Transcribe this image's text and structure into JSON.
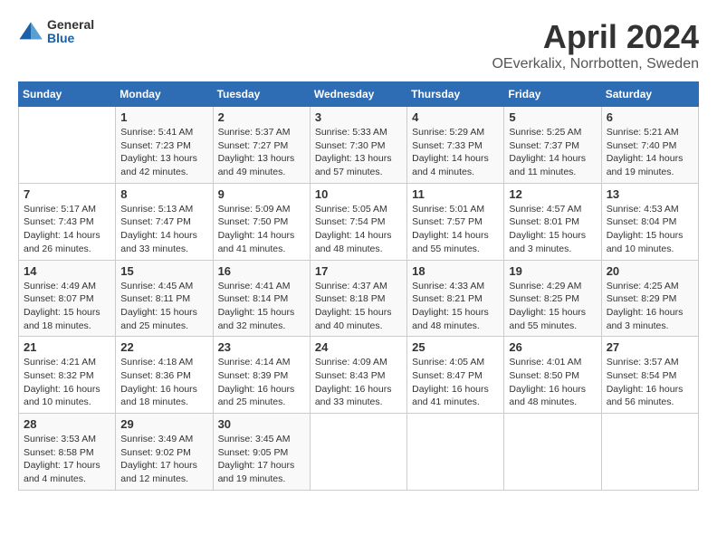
{
  "header": {
    "logo": {
      "general": "General",
      "blue": "Blue"
    },
    "title": "April 2024",
    "subtitle": "OEverkalix, Norrbotten, Sweden"
  },
  "columns": [
    "Sunday",
    "Monday",
    "Tuesday",
    "Wednesday",
    "Thursday",
    "Friday",
    "Saturday"
  ],
  "weeks": [
    [
      {
        "day": "",
        "sunrise": "",
        "sunset": "",
        "daylight": ""
      },
      {
        "day": "1",
        "sunrise": "5:41 AM",
        "sunset": "7:23 PM",
        "hours": "13 hours",
        "minutes": "and 42 minutes."
      },
      {
        "day": "2",
        "sunrise": "5:37 AM",
        "sunset": "7:27 PM",
        "hours": "13 hours",
        "minutes": "and 49 minutes."
      },
      {
        "day": "3",
        "sunrise": "5:33 AM",
        "sunset": "7:30 PM",
        "hours": "13 hours",
        "minutes": "and 57 minutes."
      },
      {
        "day": "4",
        "sunrise": "5:29 AM",
        "sunset": "7:33 PM",
        "hours": "14 hours",
        "minutes": "and 4 minutes."
      },
      {
        "day": "5",
        "sunrise": "5:25 AM",
        "sunset": "7:37 PM",
        "hours": "14 hours",
        "minutes": "and 11 minutes."
      },
      {
        "day": "6",
        "sunrise": "5:21 AM",
        "sunset": "7:40 PM",
        "hours": "14 hours",
        "minutes": "and 19 minutes."
      }
    ],
    [
      {
        "day": "7",
        "sunrise": "5:17 AM",
        "sunset": "7:43 PM",
        "hours": "14 hours",
        "minutes": "and 26 minutes."
      },
      {
        "day": "8",
        "sunrise": "5:13 AM",
        "sunset": "7:47 PM",
        "hours": "14 hours",
        "minutes": "and 33 minutes."
      },
      {
        "day": "9",
        "sunrise": "5:09 AM",
        "sunset": "7:50 PM",
        "hours": "14 hours",
        "minutes": "and 41 minutes."
      },
      {
        "day": "10",
        "sunrise": "5:05 AM",
        "sunset": "7:54 PM",
        "hours": "14 hours",
        "minutes": "and 48 minutes."
      },
      {
        "day": "11",
        "sunrise": "5:01 AM",
        "sunset": "7:57 PM",
        "hours": "14 hours",
        "minutes": "and 55 minutes."
      },
      {
        "day": "12",
        "sunrise": "4:57 AM",
        "sunset": "8:01 PM",
        "hours": "15 hours",
        "minutes": "and 3 minutes."
      },
      {
        "day": "13",
        "sunrise": "4:53 AM",
        "sunset": "8:04 PM",
        "hours": "15 hours",
        "minutes": "and 10 minutes."
      }
    ],
    [
      {
        "day": "14",
        "sunrise": "4:49 AM",
        "sunset": "8:07 PM",
        "hours": "15 hours",
        "minutes": "and 18 minutes."
      },
      {
        "day": "15",
        "sunrise": "4:45 AM",
        "sunset": "8:11 PM",
        "hours": "15 hours",
        "minutes": "and 25 minutes."
      },
      {
        "day": "16",
        "sunrise": "4:41 AM",
        "sunset": "8:14 PM",
        "hours": "15 hours",
        "minutes": "and 32 minutes."
      },
      {
        "day": "17",
        "sunrise": "4:37 AM",
        "sunset": "8:18 PM",
        "hours": "15 hours",
        "minutes": "and 40 minutes."
      },
      {
        "day": "18",
        "sunrise": "4:33 AM",
        "sunset": "8:21 PM",
        "hours": "15 hours",
        "minutes": "and 48 minutes."
      },
      {
        "day": "19",
        "sunrise": "4:29 AM",
        "sunset": "8:25 PM",
        "hours": "15 hours",
        "minutes": "and 55 minutes."
      },
      {
        "day": "20",
        "sunrise": "4:25 AM",
        "sunset": "8:29 PM",
        "hours": "16 hours",
        "minutes": "and 3 minutes."
      }
    ],
    [
      {
        "day": "21",
        "sunrise": "4:21 AM",
        "sunset": "8:32 PM",
        "hours": "16 hours",
        "minutes": "and 10 minutes."
      },
      {
        "day": "22",
        "sunrise": "4:18 AM",
        "sunset": "8:36 PM",
        "hours": "16 hours",
        "minutes": "and 18 minutes."
      },
      {
        "day": "23",
        "sunrise": "4:14 AM",
        "sunset": "8:39 PM",
        "hours": "16 hours",
        "minutes": "and 25 minutes."
      },
      {
        "day": "24",
        "sunrise": "4:09 AM",
        "sunset": "8:43 PM",
        "hours": "16 hours",
        "minutes": "and 33 minutes."
      },
      {
        "day": "25",
        "sunrise": "4:05 AM",
        "sunset": "8:47 PM",
        "hours": "16 hours",
        "minutes": "and 41 minutes."
      },
      {
        "day": "26",
        "sunrise": "4:01 AM",
        "sunset": "8:50 PM",
        "hours": "16 hours",
        "minutes": "and 48 minutes."
      },
      {
        "day": "27",
        "sunrise": "3:57 AM",
        "sunset": "8:54 PM",
        "hours": "16 hours",
        "minutes": "and 56 minutes."
      }
    ],
    [
      {
        "day": "28",
        "sunrise": "3:53 AM",
        "sunset": "8:58 PM",
        "hours": "17 hours",
        "minutes": "and 4 minutes."
      },
      {
        "day": "29",
        "sunrise": "3:49 AM",
        "sunset": "9:02 PM",
        "hours": "17 hours",
        "minutes": "and 12 minutes."
      },
      {
        "day": "30",
        "sunrise": "3:45 AM",
        "sunset": "9:05 PM",
        "hours": "17 hours",
        "minutes": "and 19 minutes."
      },
      {
        "day": "",
        "sunrise": "",
        "sunset": "",
        "hours": "",
        "minutes": ""
      },
      {
        "day": "",
        "sunrise": "",
        "sunset": "",
        "hours": "",
        "minutes": ""
      },
      {
        "day": "",
        "sunrise": "",
        "sunset": "",
        "hours": "",
        "minutes": ""
      },
      {
        "day": "",
        "sunrise": "",
        "sunset": "",
        "hours": "",
        "minutes": ""
      }
    ]
  ],
  "labels": {
    "sunrise": "Sunrise:",
    "sunset": "Sunset:",
    "daylight": "Daylight:"
  }
}
